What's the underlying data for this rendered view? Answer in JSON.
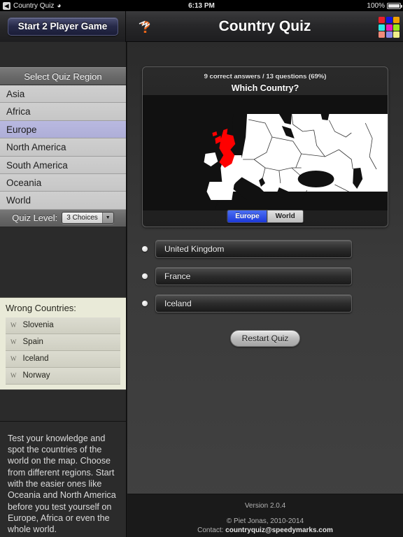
{
  "statusbar": {
    "back_glyph": "◀",
    "app_name": "Country Quiz",
    "wifi_icon": "wifi-icon",
    "time": "6:13 PM",
    "battery_percent": "100%"
  },
  "navbar": {
    "two_player_button": "Start 2 Player Game",
    "help_icon": "question-mark-icon",
    "title": "Country Quiz",
    "grid_icon": "color-grid-icon",
    "grid_colors": [
      "#e8202a",
      "#1414e0",
      "#f0a000",
      "#2ee8e8",
      "#ec18bc",
      "#9ae818",
      "#f08a7a",
      "#8a8ae8",
      "#f0ee8a"
    ]
  },
  "sidebar": {
    "region_header": "Select Quiz Region",
    "regions": [
      {
        "label": "Asia",
        "selected": false
      },
      {
        "label": "Africa",
        "selected": false
      },
      {
        "label": "Europe",
        "selected": true
      },
      {
        "label": "North America",
        "selected": false
      },
      {
        "label": "South America",
        "selected": false
      },
      {
        "label": "Oceania",
        "selected": false
      },
      {
        "label": "World",
        "selected": false
      }
    ],
    "quiz_level_label": "Quiz Level:",
    "quiz_level_value": "3 Choices",
    "quiz_level_arrow": "▼",
    "wrong_title": "Wrong Countries:",
    "wrong_countries": [
      {
        "flag": "W",
        "name": "Slovenia"
      },
      {
        "flag": "W",
        "name": "Spain"
      },
      {
        "flag": "W",
        "name": "Iceland"
      },
      {
        "flag": "W",
        "name": "Norway"
      }
    ],
    "about_text": "Test your knowledge and spot the countries of the world on the map. Choose from different regions. Start with the easier ones like Oceania and North America before you test yourself on Europe, Africa or even the whole world."
  },
  "main": {
    "score_line": "9 correct answers / 13 questions (69%)",
    "question": "Which Country?",
    "map_region": "Europe",
    "highlight_color": "#ff0000",
    "land_color": "#ffffff",
    "sea_color": "#000000",
    "toggle": [
      {
        "label": "Europe",
        "active": true
      },
      {
        "label": "World",
        "active": false
      }
    ],
    "answers": [
      {
        "label": "United Kingdom"
      },
      {
        "label": "France"
      },
      {
        "label": "Iceland"
      }
    ],
    "restart_button": "Restart Quiz"
  },
  "footer": {
    "version": "Version 2.0.4",
    "copyright": "© Piet Jonas, 2010-2014",
    "contact_prefix": "Contact: ",
    "contact_email": "countryquiz@speedymarks.com"
  }
}
